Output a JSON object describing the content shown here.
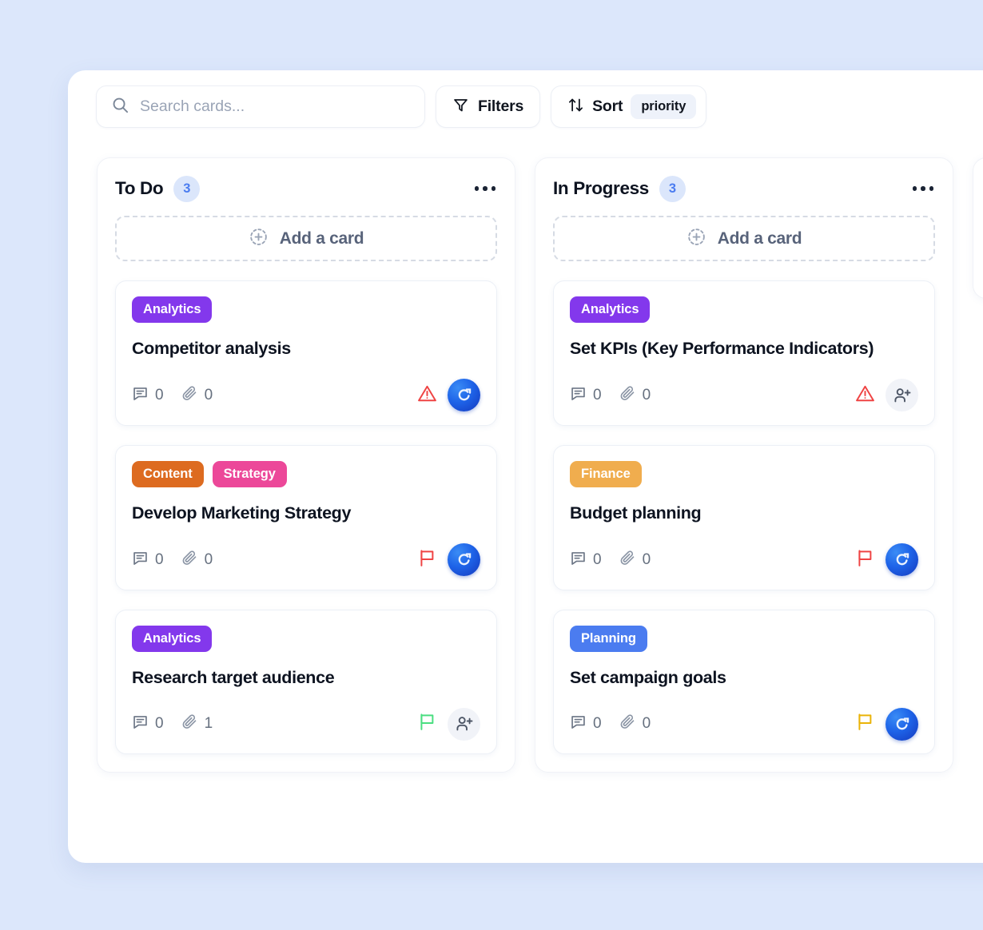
{
  "theme": {
    "page_background": "#dce7fb",
    "panel_background": "#ffffff",
    "accent": "#4b7cf0",
    "count_badge_bg": "#dbe6fb"
  },
  "toolbar": {
    "search_placeholder": "Search cards...",
    "search_value": "",
    "search_icon": "search-icon",
    "filters_label": "Filters",
    "filters_icon": "funnel-filter-icon",
    "sort_label": "Sort",
    "sort_icon": "sort-arrows-icon",
    "sort_value": "priority"
  },
  "columns": [
    {
      "title": "To Do",
      "count": "3",
      "menu_icon": "ellipsis-icon",
      "add_card_label": "Add a card",
      "add_card_icon": "plus-circle-dashed-icon",
      "cards": [
        {
          "tags": [
            {
              "label": "Analytics",
              "color": "#8338ec"
            }
          ],
          "title": "Competitor analysis",
          "comments": "0",
          "attachments": "0",
          "comments_icon": "comment-icon",
          "attachments_icon": "paperclip-icon",
          "status_icon": "warning-triangle-icon",
          "status_color": "#ef4444",
          "assignee": {
            "type": "avatar",
            "icon": "user-avatar-glyph"
          }
        },
        {
          "tags": [
            {
              "label": "Content",
              "color": "#dd6b20"
            },
            {
              "label": "Strategy",
              "color": "#ec4899"
            }
          ],
          "title": "Develop Marketing Strategy",
          "comments": "0",
          "attachments": "0",
          "comments_icon": "comment-icon",
          "attachments_icon": "paperclip-icon",
          "status_icon": "flag-icon",
          "status_color": "#ef4444",
          "assignee": {
            "type": "avatar",
            "icon": "user-avatar-glyph"
          }
        },
        {
          "tags": [
            {
              "label": "Analytics",
              "color": "#8338ec"
            }
          ],
          "title": "Research target audience",
          "comments": "0",
          "attachments": "1",
          "comments_icon": "comment-icon",
          "attachments_icon": "paperclip-icon",
          "status_icon": "flag-icon",
          "status_color": "#4ade80",
          "assignee": {
            "type": "assign",
            "icon": "add-person-icon"
          }
        }
      ]
    },
    {
      "title": "In Progress",
      "count": "3",
      "menu_icon": "ellipsis-icon",
      "add_card_label": "Add a card",
      "add_card_icon": "plus-circle-dashed-icon",
      "cards": [
        {
          "tags": [
            {
              "label": "Analytics",
              "color": "#8338ec"
            }
          ],
          "title": "Set KPIs (Key Performance Indicators)",
          "comments": "0",
          "attachments": "0",
          "comments_icon": "comment-icon",
          "attachments_icon": "paperclip-icon",
          "status_icon": "warning-triangle-icon",
          "status_color": "#ef4444",
          "assignee": {
            "type": "assign",
            "icon": "add-person-icon"
          }
        },
        {
          "tags": [
            {
              "label": "Finance",
              "color": "#f0ad4e"
            }
          ],
          "title": "Budget planning",
          "comments": "0",
          "attachments": "0",
          "comments_icon": "comment-icon",
          "attachments_icon": "paperclip-icon",
          "status_icon": "flag-icon",
          "status_color": "#ef4444",
          "assignee": {
            "type": "avatar",
            "icon": "user-avatar-glyph"
          }
        },
        {
          "tags": [
            {
              "label": "Planning",
              "color": "#4b7cf0"
            }
          ],
          "title": "Set campaign goals",
          "comments": "0",
          "attachments": "0",
          "comments_icon": "comment-icon",
          "attachments_icon": "paperclip-icon",
          "status_icon": "flag-icon",
          "status_color": "#eab308",
          "assignee": {
            "type": "avatar",
            "icon": "user-avatar-glyph"
          }
        }
      ]
    },
    {
      "title": "",
      "count": "",
      "menu_icon": "ellipsis-icon",
      "add_card_label": "",
      "add_card_icon": "plus-circle-dashed-icon",
      "cards": []
    }
  ]
}
